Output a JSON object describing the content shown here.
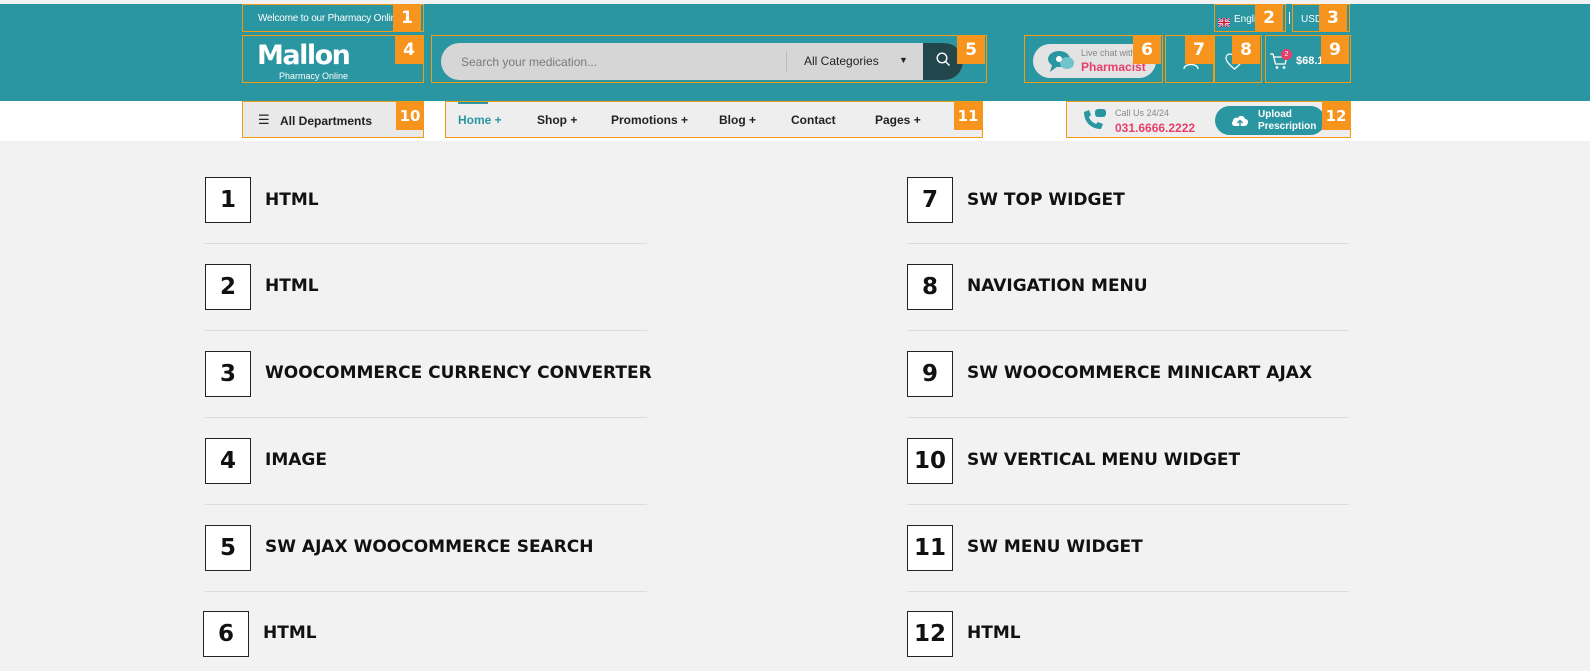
{
  "header": {
    "welcome": "Welcome to our Pharmacy Online",
    "language": "English",
    "currency": "USD",
    "logo": {
      "name": "Mallon",
      "tagline": "Pharmacy Online"
    },
    "search": {
      "placeholder": "Search your medication...",
      "category": "All Categories"
    },
    "chat": {
      "small": "Live chat with",
      "big": "Pharmacist"
    },
    "cart": {
      "count": "2",
      "total": "$68.14"
    }
  },
  "nav": {
    "departments": "All Departments",
    "menu": [
      "Home +",
      "Shop +",
      "Promotions +",
      "Blog +",
      "Contact",
      "Pages +"
    ],
    "call": {
      "label": "Call Us 24/24",
      "number": "031.6666.2222"
    },
    "upload": {
      "line1": "Upload",
      "line2": "Prescription"
    }
  },
  "badges": [
    "1",
    "2",
    "3",
    "4",
    "5",
    "6",
    "7",
    "8",
    "9",
    "10",
    "11",
    "12"
  ],
  "legend": [
    {
      "no": "1",
      "label": "HTML"
    },
    {
      "no": "2",
      "label": "HTML"
    },
    {
      "no": "3",
      "label": "WOOCOMMERCE CURRENCY CONVERTER"
    },
    {
      "no": "4",
      "label": "IMAGE"
    },
    {
      "no": "5",
      "label": "SW AJAX WOOCOMMERCE SEARCH"
    },
    {
      "no": "6",
      "label": "HTML"
    },
    {
      "no": "7",
      "label": "SW TOP WIDGET"
    },
    {
      "no": "8",
      "label": "NAVIGATION MENU"
    },
    {
      "no": "9",
      "label": "SW WOOCOMMERCE MINICART AJAX"
    },
    {
      "no": "10",
      "label": "SW VERTICAL MENU WIDGET"
    },
    {
      "no": "11",
      "label": "SW MENU WIDGET"
    },
    {
      "no": "12",
      "label": "HTML"
    }
  ],
  "colors": {
    "header": "#2a96a1",
    "badge": "#f7941d",
    "highlight": "#e83e6c",
    "search_button": "#21474d"
  }
}
